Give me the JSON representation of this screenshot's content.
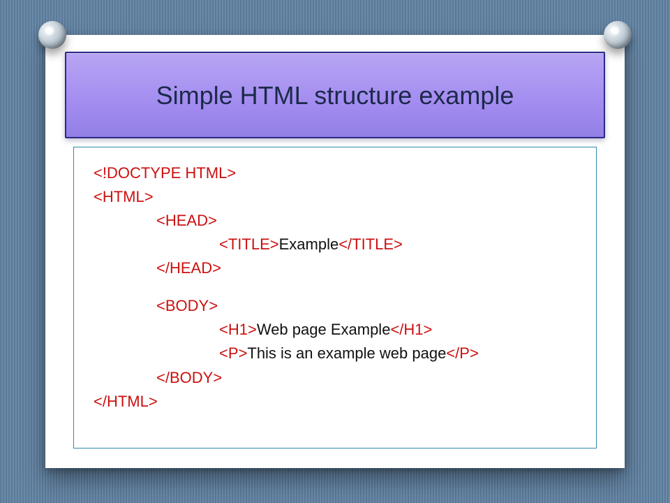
{
  "title": "Simple HTML structure example",
  "code": {
    "doctype": "<!DOCTYPE HTML>",
    "html_open": "<HTML>",
    "head_open": "<HEAD>",
    "title_open": "<TITLE>",
    "title_text": "Example",
    "title_close": "</TITLE>",
    "head_close": "</HEAD>",
    "body_open": "<BODY>",
    "h1_open": "<H1>",
    "h1_text": "Web page Example",
    "h1_close": "</H1>",
    "p_open": "<P>",
    "p_text": "This is an example web page",
    "p_close": "</P>",
    "body_close": "</BODY>",
    "html_close": "</HTML>"
  }
}
